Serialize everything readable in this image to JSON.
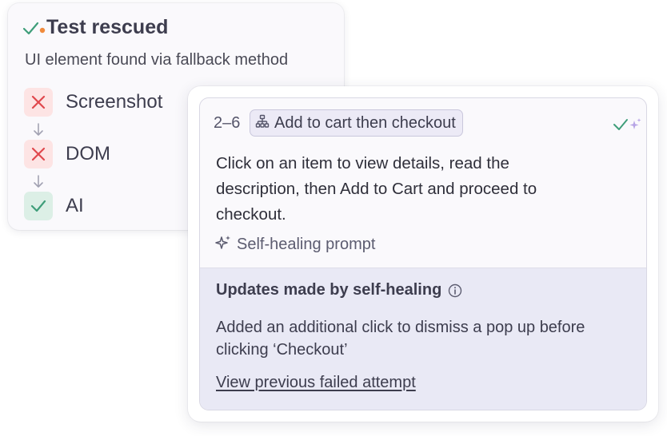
{
  "rescue_card": {
    "title": "Test rescued",
    "subtitle": "UI element found via fallback method",
    "steps": [
      {
        "label": "Screenshot",
        "status": "fail"
      },
      {
        "label": "DOM",
        "status": "fail"
      },
      {
        "label": "AI",
        "status": "success"
      }
    ]
  },
  "step_card": {
    "step_range": "2–6",
    "tag_label": "Add to cart then checkout",
    "prompt": "Click on an item to view details, read the description, then Add to Cart and proceed to checkout.",
    "self_healing_label": "Self-healing prompt",
    "updates": {
      "title": "Updates made by self-healing",
      "description": "Added an additional click to dismiss a pop up before clicking ‘Checkout’",
      "link": "View previous failed attempt"
    }
  },
  "colors": {
    "success": "#3f9e7a",
    "fail": "#e0484d",
    "accent_dot": "#f08a3c",
    "sparkle": "#b7a4e6"
  },
  "icons": [
    "check-dot-icon",
    "x-icon",
    "check-icon",
    "arrow-down-icon",
    "sitemap-icon",
    "check-sparkle-icon",
    "sparkle-icon",
    "info-icon"
  ]
}
